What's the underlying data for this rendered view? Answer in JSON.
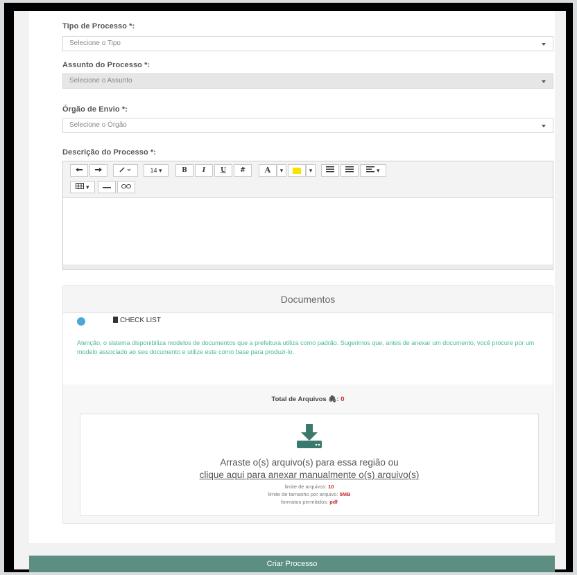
{
  "form": {
    "tipo_label": "Tipo de Processo *:",
    "tipo_placeholder": "Selecione o Tipo",
    "assunto_label": "Assunto do Processo *:",
    "assunto_placeholder": "Selecione o Assunto",
    "orgao_label": "Órgão de Envio *:",
    "orgao_placeholder": "Selecione o Órgão",
    "descricao_label": "Descrição do Processo *:"
  },
  "toolbar": {
    "font_size": "14",
    "bold": "B",
    "italic": "I",
    "underline": "U",
    "clear_format": "#",
    "font_color": "A",
    "highlight_color": "#f5e400",
    "icons": [
      "undo-icon",
      "redo-icon",
      "magic-icon",
      "font-size-dropdown",
      "bold-icon",
      "italic-icon",
      "underline-icon",
      "eraser-icon",
      "font-color-icon",
      "highlight-icon",
      "unordered-list-icon",
      "ordered-list-icon",
      "align-icon",
      "table-icon",
      "hr-icon",
      "link-icon"
    ]
  },
  "documents": {
    "title": "Documentos",
    "tab_checklist": "CHECK LIST",
    "notice": "Atenção, o sistema disponibiliza modelos de documentos que a prefeitura utiliza como padrão. Sugerimos que, antes de anexar um documento, você procure por um modelo associado ao seu documento e utilize este como base para produzi-lo.",
    "total_label": "Total de Arquivos",
    "total_count": "0",
    "drop_line1": "Arraste o(s) arquivo(s) para essa região ou",
    "drop_line2": "clique aqui para anexar manualmente o(s) arquivo(s)",
    "limit_files_label": "limite de arquivos:",
    "limit_files_value": "10",
    "limit_size_label": "limite de tamanho por arquivo:",
    "limit_size_value": "5MB",
    "formats_label": "formatos permitidos:",
    "formats_value": "pdf"
  },
  "submit_label": "Criar Processo",
  "colors": {
    "accent_green": "#5c8f82",
    "notice_text": "#48b89a",
    "info_blue": "#4aa8d8",
    "emphasis_red": "#c62828"
  }
}
